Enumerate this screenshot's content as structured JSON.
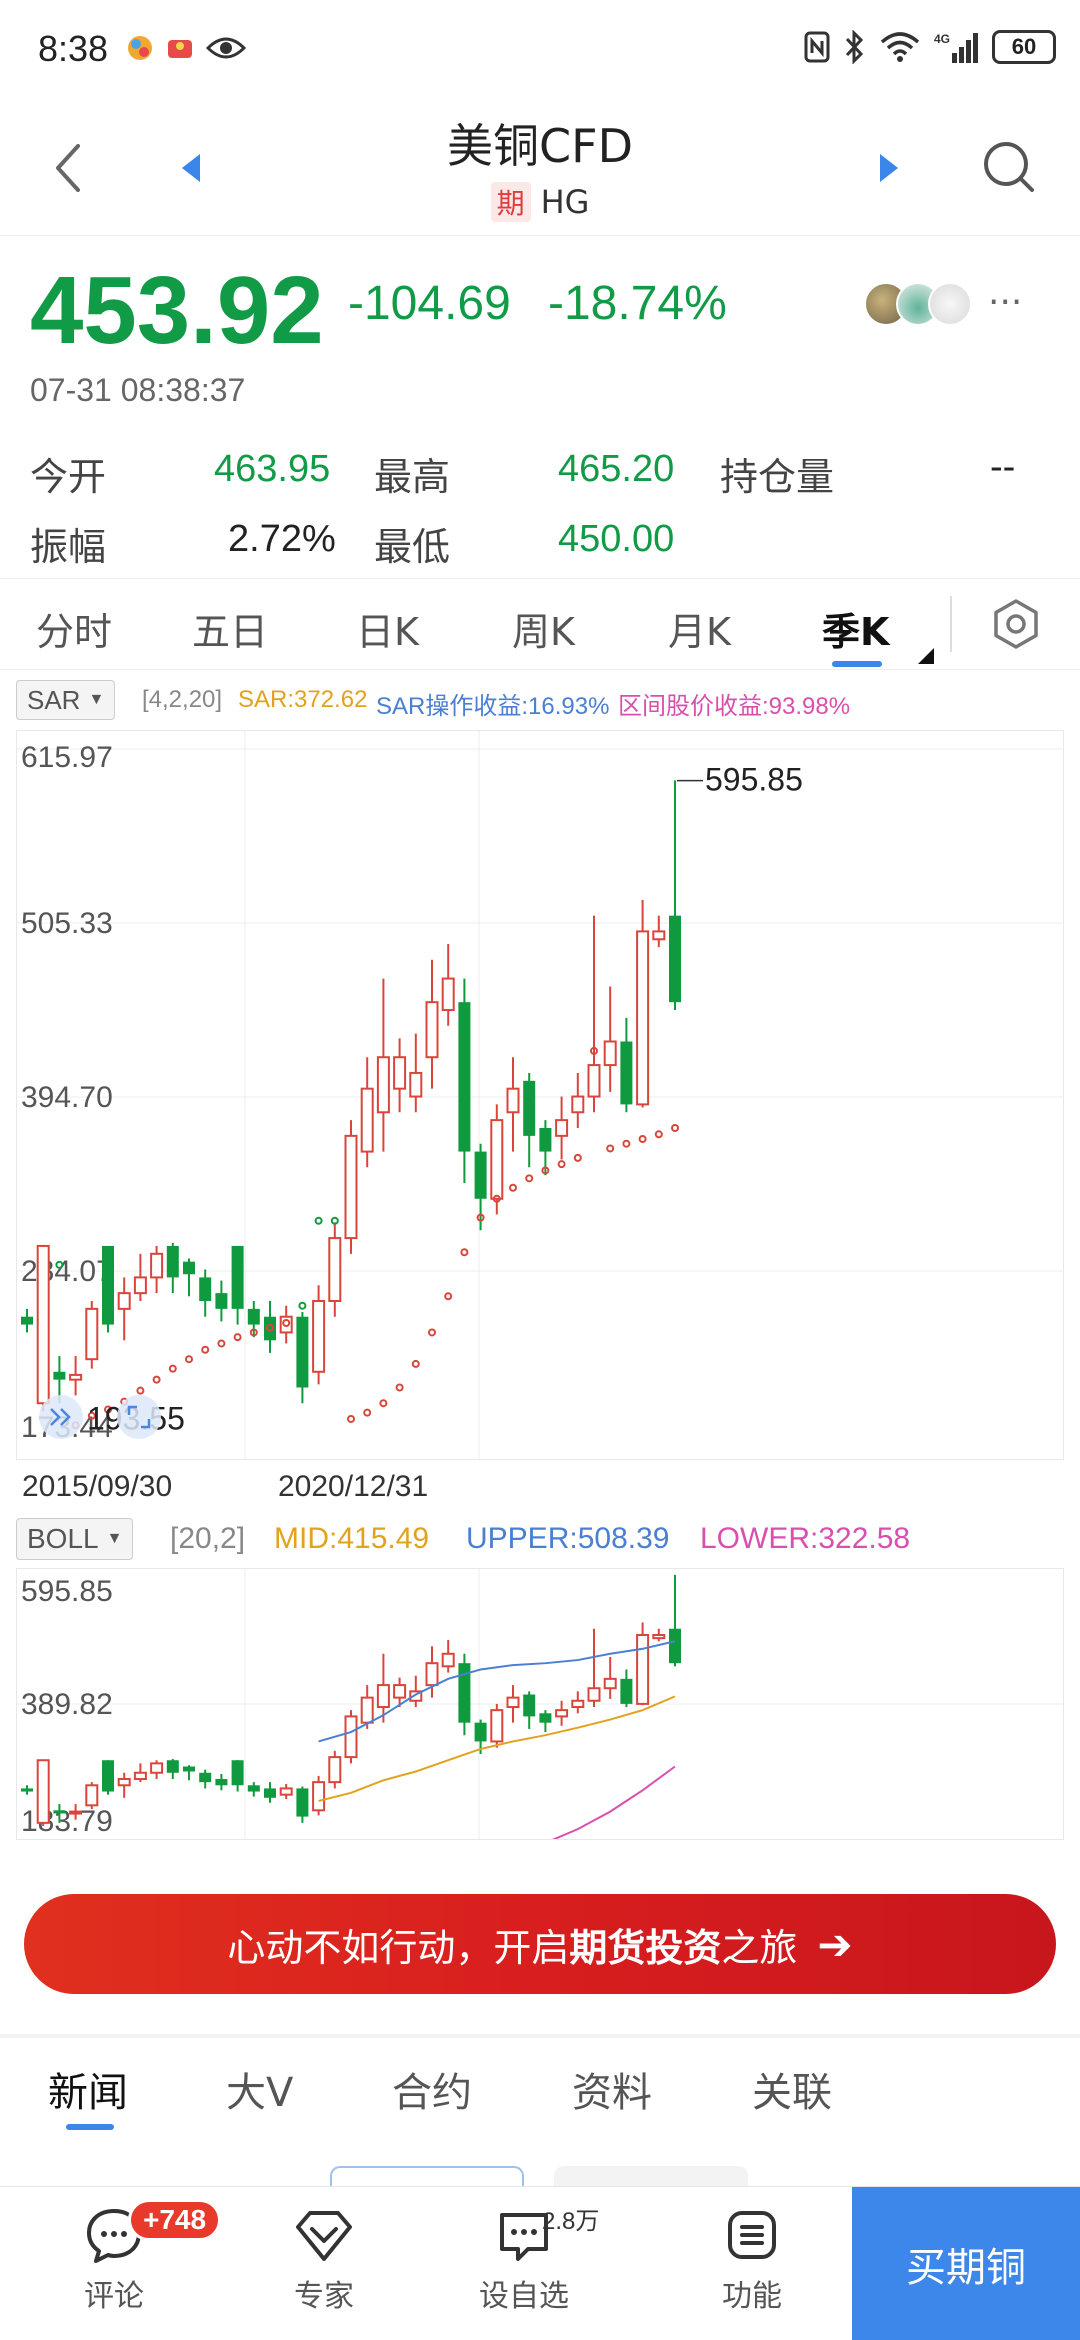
{
  "status_bar": {
    "time": "8:38",
    "battery": "60",
    "network": "4G"
  },
  "header": {
    "title": "美铜CFD",
    "tag": "期",
    "symbol": "HG"
  },
  "quote": {
    "price": "453.92",
    "change": "-104.69",
    "change_pct": "-18.74%",
    "timestamp": "07-31 08:38:37",
    "more": "···"
  },
  "stats": {
    "open_label": "今开",
    "open_value": "463.95",
    "high_label": "最高",
    "high_value": "465.20",
    "oi_label": "持仓量",
    "oi_value": "--",
    "amp_label": "振幅",
    "amp_value": "2.72%",
    "low_label": "最低",
    "low_value": "450.00"
  },
  "period_tabs": [
    "分时",
    "五日",
    "日K",
    "周K",
    "月K",
    "季K"
  ],
  "active_period": "季K",
  "sar": {
    "name": "SAR",
    "params": "[4,2,20]",
    "value": "SAR:372.62",
    "op_return": "SAR操作收益:16.93%",
    "range_return": "区间股价收益:93.98%"
  },
  "boll": {
    "name": "BOLL",
    "params": "[20,2]",
    "mid": "MID:415.49",
    "upper": "UPPER:508.39",
    "lower": "LOWER:322.58"
  },
  "chart_data": [
    {
      "type": "candlestick",
      "y_ticks": [
        "615.97",
        "505.33",
        "394.70",
        "284.07",
        "173.44"
      ],
      "ylim": [
        173.44,
        615.97
      ],
      "x_ticks": [
        "2015/09/30",
        "2020/12/31"
      ],
      "max_annotation": "595.85",
      "min_annotation": "193.55",
      "candles": [
        {
          "o": 255,
          "c": 250,
          "h": 260,
          "l": 245
        },
        {
          "o": 200,
          "c": 300,
          "h": 300,
          "l": 195
        },
        {
          "o": 220,
          "c": 215,
          "h": 230,
          "l": 200
        },
        {
          "o": 215,
          "c": 218,
          "h": 230,
          "l": 205
        },
        {
          "o": 228,
          "c": 260,
          "h": 265,
          "l": 222
        },
        {
          "o": 300,
          "c": 250,
          "h": 300,
          "l": 245
        },
        {
          "o": 260,
          "c": 270,
          "h": 280,
          "l": 240
        },
        {
          "o": 270,
          "c": 280,
          "h": 295,
          "l": 265
        },
        {
          "o": 280,
          "c": 295,
          "h": 300,
          "l": 270
        },
        {
          "o": 300,
          "c": 280,
          "h": 302,
          "l": 270
        },
        {
          "o": 290,
          "c": 282,
          "h": 292,
          "l": 268
        },
        {
          "o": 280,
          "c": 265,
          "h": 285,
          "l": 255
        },
        {
          "o": 270,
          "c": 260,
          "h": 278,
          "l": 252
        },
        {
          "o": 300,
          "c": 260,
          "h": 300,
          "l": 250
        },
        {
          "o": 260,
          "c": 250,
          "h": 265,
          "l": 242
        },
        {
          "o": 255,
          "c": 240,
          "h": 265,
          "l": 232
        },
        {
          "o": 245,
          "c": 255,
          "h": 262,
          "l": 238
        },
        {
          "o": 255,
          "c": 210,
          "h": 258,
          "l": 200
        },
        {
          "o": 220,
          "c": 265,
          "h": 275,
          "l": 212
        },
        {
          "o": 265,
          "c": 305,
          "h": 315,
          "l": 255
        },
        {
          "o": 305,
          "c": 370,
          "h": 380,
          "l": 295
        },
        {
          "o": 360,
          "c": 400,
          "h": 420,
          "l": 350
        },
        {
          "o": 385,
          "c": 420,
          "h": 470,
          "l": 360
        },
        {
          "o": 400,
          "c": 420,
          "h": 432,
          "l": 385
        },
        {
          "o": 395,
          "c": 410,
          "h": 435,
          "l": 385
        },
        {
          "o": 420,
          "c": 455,
          "h": 482,
          "l": 400
        },
        {
          "o": 450,
          "c": 470,
          "h": 492,
          "l": 440
        },
        {
          "o": 455,
          "c": 360,
          "h": 470,
          "l": 340
        },
        {
          "o": 360,
          "c": 330,
          "h": 365,
          "l": 310
        },
        {
          "o": 330,
          "c": 380,
          "h": 390,
          "l": 320
        },
        {
          "o": 385,
          "c": 400,
          "h": 420,
          "l": 360
        },
        {
          "o": 405,
          "c": 370,
          "h": 410,
          "l": 350
        },
        {
          "o": 375,
          "c": 360,
          "h": 380,
          "l": 345
        },
        {
          "o": 370,
          "c": 380,
          "h": 395,
          "l": 355
        },
        {
          "o": 385,
          "c": 395,
          "h": 410,
          "l": 375
        },
        {
          "o": 395,
          "c": 415,
          "h": 510,
          "l": 385
        },
        {
          "o": 415,
          "c": 430,
          "h": 465,
          "l": 398
        },
        {
          "o": 430,
          "c": 390,
          "h": 445,
          "l": 385
        },
        {
          "o": 390,
          "c": 500,
          "h": 520,
          "l": 388
        },
        {
          "o": 495,
          "c": 500,
          "h": 510,
          "l": 490
        },
        {
          "o": 510,
          "c": 455,
          "h": 596,
          "l": 450
        }
      ],
      "sar_points": [
        {
          "i": 2,
          "v": 288
        },
        {
          "i": 3,
          "v": 186
        },
        {
          "i": 4,
          "v": 192
        },
        {
          "i": 5,
          "v": 196
        },
        {
          "i": 6,
          "v": 201
        },
        {
          "i": 7,
          "v": 208
        },
        {
          "i": 8,
          "v": 215
        },
        {
          "i": 9,
          "v": 222
        },
        {
          "i": 10,
          "v": 228
        },
        {
          "i": 11,
          "v": 234
        },
        {
          "i": 12,
          "v": 238
        },
        {
          "i": 13,
          "v": 242
        },
        {
          "i": 14,
          "v": 245
        },
        {
          "i": 15,
          "v": 248
        },
        {
          "i": 16,
          "v": 251
        },
        {
          "i": 17,
          "v": 262
        },
        {
          "i": 18,
          "v": 316
        },
        {
          "i": 19,
          "v": 316
        },
        {
          "i": 20,
          "v": 190
        },
        {
          "i": 21,
          "v": 194
        },
        {
          "i": 22,
          "v": 200
        },
        {
          "i": 23,
          "v": 210
        },
        {
          "i": 24,
          "v": 225
        },
        {
          "i": 25,
          "v": 245
        },
        {
          "i": 26,
          "v": 268
        },
        {
          "i": 27,
          "v": 296
        },
        {
          "i": 28,
          "v": 318
        },
        {
          "i": 29,
          "v": 330
        },
        {
          "i": 30,
          "v": 337
        },
        {
          "i": 31,
          "v": 343
        },
        {
          "i": 32,
          "v": 348
        },
        {
          "i": 33,
          "v": 352
        },
        {
          "i": 34,
          "v": 356
        },
        {
          "i": 35,
          "v": 424
        },
        {
          "i": 36,
          "v": 362
        },
        {
          "i": 37,
          "v": 365
        },
        {
          "i": 38,
          "v": 368
        },
        {
          "i": 39,
          "v": 371
        },
        {
          "i": 40,
          "v": 375
        }
      ]
    },
    {
      "type": "boll",
      "y_ticks": [
        "595.85",
        "389.82",
        "183.79"
      ],
      "ylim": [
        183.79,
        595.85
      ],
      "upper_band": [
        [
          18,
          330
        ],
        [
          20,
          345
        ],
        [
          22,
          372
        ],
        [
          24,
          405
        ],
        [
          26,
          430
        ],
        [
          28,
          445
        ],
        [
          30,
          452
        ],
        [
          32,
          455
        ],
        [
          34,
          460
        ],
        [
          36,
          470
        ],
        [
          38,
          478
        ],
        [
          40,
          490
        ]
      ],
      "mid_band": [
        [
          18,
          235
        ],
        [
          20,
          248
        ],
        [
          22,
          268
        ],
        [
          24,
          282
        ],
        [
          26,
          300
        ],
        [
          28,
          318
        ],
        [
          30,
          330
        ],
        [
          32,
          340
        ],
        [
          34,
          352
        ],
        [
          36,
          365
        ],
        [
          38,
          380
        ],
        [
          40,
          402
        ]
      ],
      "lower_band": [
        [
          18,
          120
        ],
        [
          20,
          118
        ],
        [
          22,
          112
        ],
        [
          24,
          118
        ],
        [
          26,
          124
        ],
        [
          28,
          136
        ],
        [
          30,
          150
        ],
        [
          32,
          168
        ],
        [
          34,
          190
        ],
        [
          36,
          218
        ],
        [
          38,
          252
        ],
        [
          40,
          290
        ]
      ]
    }
  ],
  "banner": {
    "pre": "心动不如行动，开启",
    "bold": "期货投资",
    "post": "之旅",
    "arrow": "➔"
  },
  "news_tabs": [
    "新闻",
    "大V",
    "合约",
    "资料",
    "关联"
  ],
  "bottom_nav": {
    "comment_label": "评论",
    "comment_badge": "+748",
    "expert_label": "专家",
    "watch_label": "设自选",
    "watch_count": "2.8万",
    "func_label": "功能",
    "buy_label": "买期铜"
  }
}
